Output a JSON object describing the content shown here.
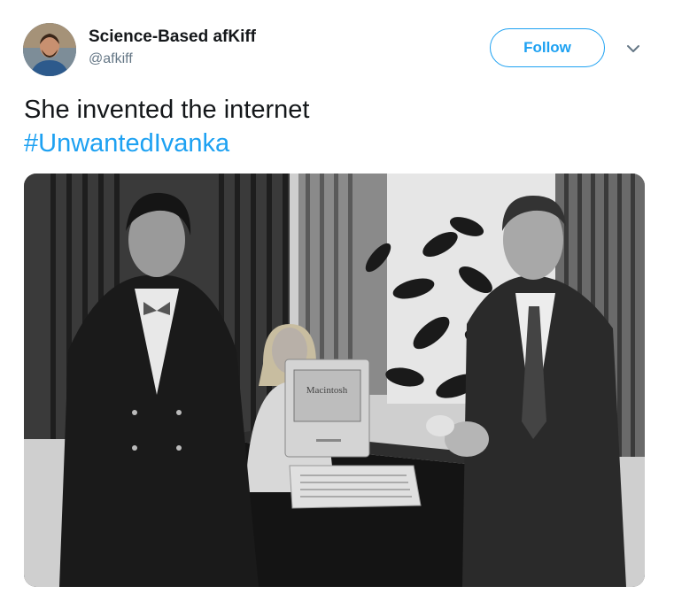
{
  "tweet": {
    "author_name": "Science-Based afKiff",
    "author_handle": "@afkiff",
    "follow_label": "Follow",
    "text_line1": "She invented the internet",
    "hashtag": "#UnwantedIvanka"
  },
  "media": {
    "computer_label": "Macintosh"
  },
  "icons": {
    "more": "chevron-down-icon",
    "avatar": "avatar"
  },
  "colors": {
    "accent": "#1da1f2",
    "text": "#14171a",
    "secondary": "#657786"
  }
}
